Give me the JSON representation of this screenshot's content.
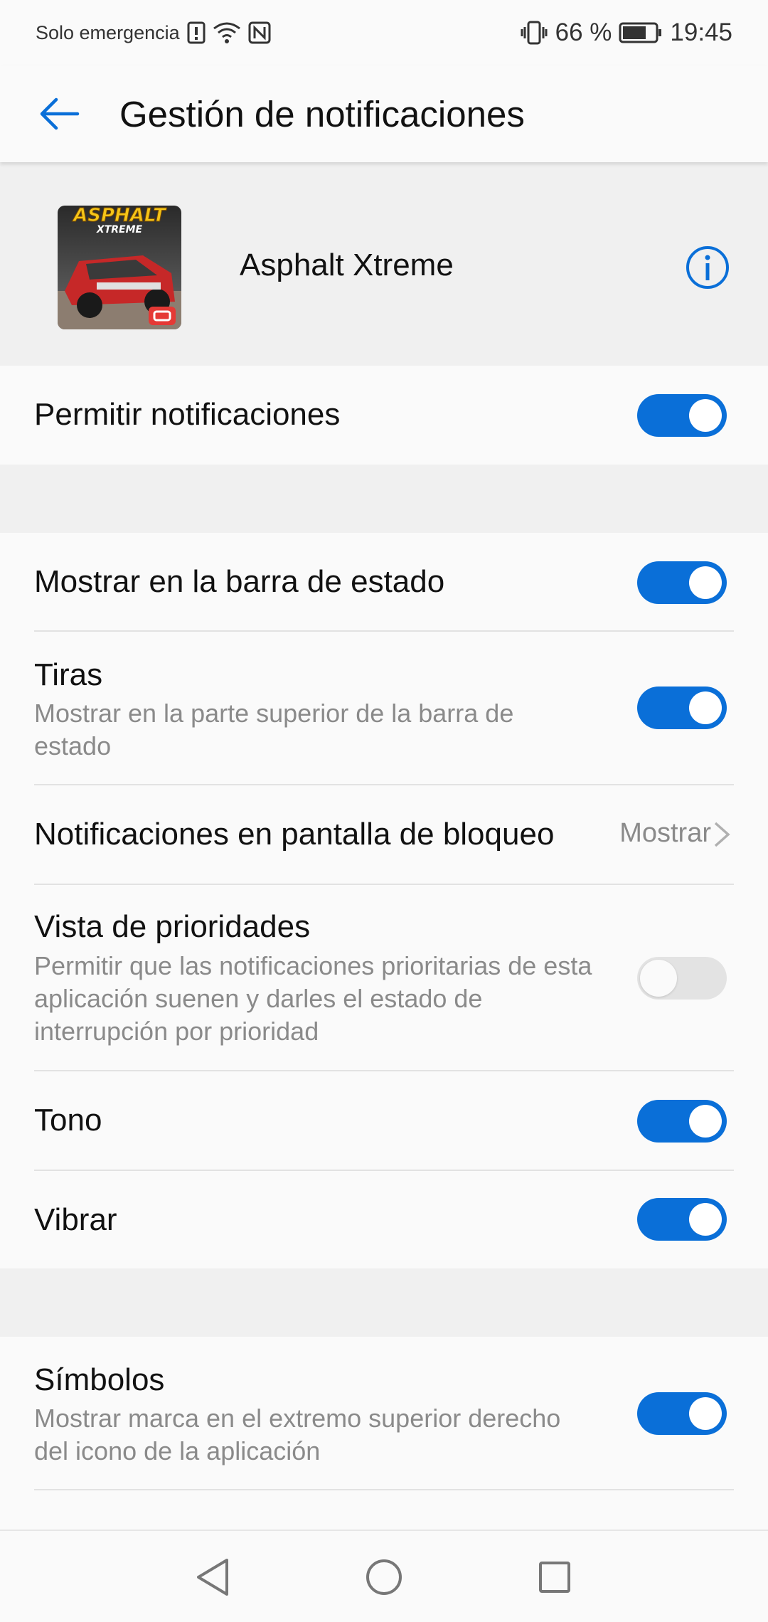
{
  "status_bar": {
    "carrier": "Solo emergencia",
    "battery_percent": "66 %",
    "time": "19:45",
    "icons": [
      "alert-icon",
      "wifi-icon",
      "nfc-icon",
      "vibrate-icon",
      "battery-icon"
    ]
  },
  "app_bar": {
    "title": "Gestión de notificaciones",
    "back_icon": "back-arrow-icon"
  },
  "app": {
    "name": "Asphalt Xtreme",
    "icon_text_line1": "ASPHALT",
    "icon_text_line2": "XTREME",
    "info_icon": "info-icon"
  },
  "settings": {
    "allow": {
      "title": "Permitir notificaciones",
      "enabled": true
    },
    "status_bar_show": {
      "title": "Mostrar en la barra de estado",
      "enabled": true
    },
    "banners": {
      "title": "Tiras",
      "subtitle": "Mostrar en la parte superior de la barra de estado",
      "enabled": true
    },
    "lock_screen": {
      "title": "Notificaciones en pantalla de bloqueo",
      "value": "Mostrar"
    },
    "priority": {
      "title": "Vista de prioridades",
      "subtitle": "Permitir que las notificaciones prioritarias de esta aplicación suenen y darles el estado de interrupción por prioridad",
      "enabled": false
    },
    "sound": {
      "title": "Tono",
      "enabled": true
    },
    "vibrate": {
      "title": "Vibrar",
      "enabled": true
    },
    "badges": {
      "title": "Símbolos",
      "subtitle": "Mostrar marca en el extremo superior derecho del icono de la aplicación",
      "enabled": true
    }
  },
  "nav_bar": {
    "icons": [
      "back-triangle-icon",
      "home-circle-icon",
      "recents-square-icon"
    ]
  },
  "colors": {
    "accent": "#0a6fd8",
    "toggle_off": "#e3e3e3",
    "subtext": "#8a8a8a",
    "header_bg": "#f0f0f0"
  }
}
